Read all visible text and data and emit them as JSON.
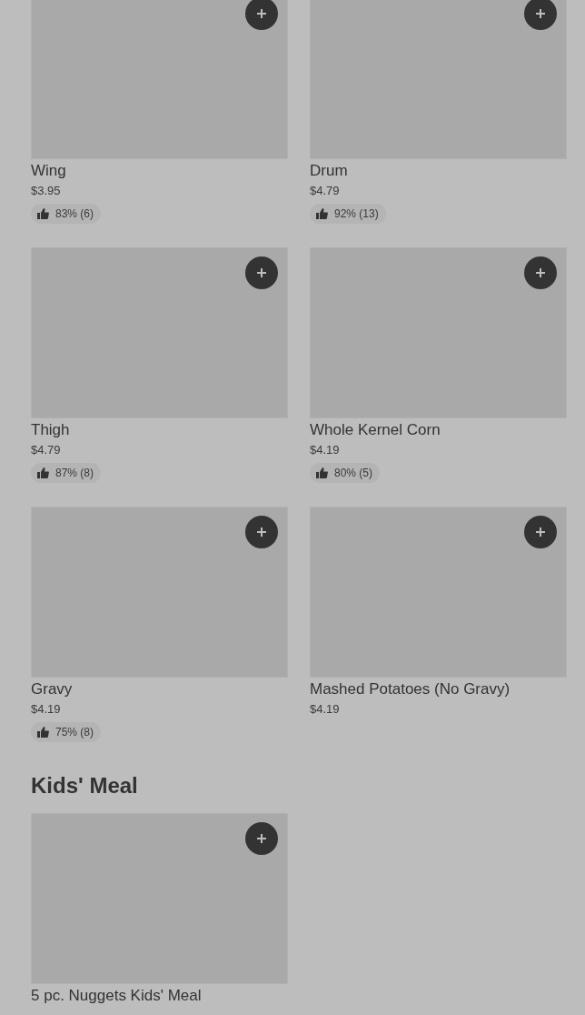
{
  "sections": [
    {
      "items": [
        {
          "name": "Wing",
          "price": "$3.95",
          "rating": "83% (6)"
        },
        {
          "name": "Drum",
          "price": "$4.79",
          "rating": "92% (13)"
        },
        {
          "name": "Thigh",
          "price": "$4.79",
          "rating": "87% (8)"
        },
        {
          "name": "Whole Kernel Corn",
          "price": "$4.19",
          "rating": "80% (5)"
        },
        {
          "name": "Gravy",
          "price": "$4.19",
          "rating": "75% (8)"
        },
        {
          "name": "Mashed Potatoes (No Gravy)",
          "price": "$4.19"
        }
      ]
    },
    {
      "title": "Kids' Meal",
      "items": [
        {
          "name": "5 pc. Nuggets Kids' Meal"
        }
      ]
    }
  ]
}
